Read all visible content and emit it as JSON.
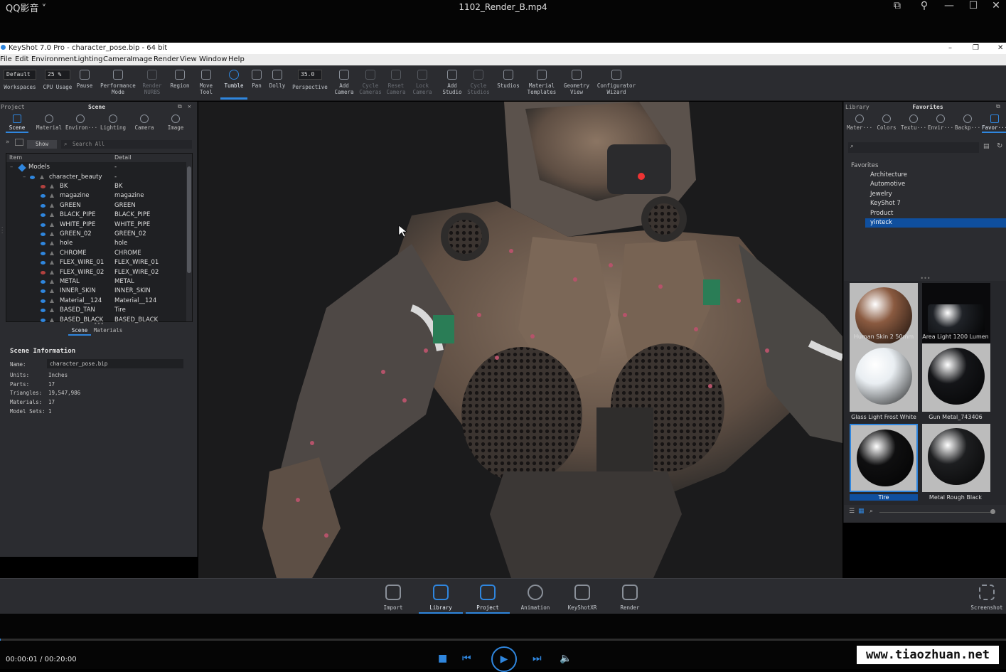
{
  "player": {
    "brand": "QQ影音 ˅",
    "file_title": "1102_Render_B.mp4",
    "time": "00:00:01 / 00:20:00",
    "progress": 0.001,
    "watermark": "www.tiaozhuan.net"
  },
  "keyshot": {
    "window_title": "KeyShot 7.0 Pro  - character_pose.bip  - 64 bit",
    "menu": [
      "File",
      "Edit",
      "Environment",
      "Lighting",
      "Camera",
      "Image",
      "Render",
      "View",
      "Window",
      "Help"
    ],
    "toolbar": {
      "workspace_value": "Default",
      "cpu_value": "25 %",
      "fov_value": "35.0",
      "items": [
        {
          "label": "Workspaces"
        },
        {
          "label": "CPU Usage"
        },
        {
          "label": "Pause"
        },
        {
          "label": "Performance Mode"
        },
        {
          "label": "Render NURBS",
          "dim": true
        },
        {
          "label": "Region"
        },
        {
          "label": "Move Tool"
        },
        {
          "label": "Tumble",
          "active": true
        },
        {
          "label": "Pan"
        },
        {
          "label": "Dolly"
        },
        {
          "label": "Perspective"
        },
        {
          "label": "Add Camera"
        },
        {
          "label": "Cycle Cameras",
          "dim": true
        },
        {
          "label": "Reset Camera",
          "dim": true
        },
        {
          "label": "Lock Camera",
          "dim": true
        },
        {
          "label": "Add Studio"
        },
        {
          "label": "Cycle Studios",
          "dim": true
        },
        {
          "label": "Studios"
        },
        {
          "label": "Material Templates"
        },
        {
          "label": "Geometry View"
        },
        {
          "label": "Configurator Wizard"
        }
      ]
    },
    "left_panel": {
      "tab_project": "Project",
      "title": "Scene",
      "tabs": [
        "Scene",
        "Material",
        "Environ···",
        "Lighting",
        "Camera",
        "Image"
      ],
      "show_button": "Show",
      "search_placeholder": "Search All",
      "col_item": "Item",
      "col_detail": "Detail",
      "root": "Models",
      "root_detail": "-",
      "group": "character_beauty",
      "group_detail": "-",
      "rows": [
        {
          "name": "BK",
          "detail": "BK",
          "hidden": true
        },
        {
          "name": "magazine",
          "detail": "magazine"
        },
        {
          "name": "GREEN",
          "detail": "GREEN"
        },
        {
          "name": "BLACK_PIPE",
          "detail": "BLACK_PIPE"
        },
        {
          "name": "WHITE_PIPE",
          "detail": "WHITE_PIPE"
        },
        {
          "name": "GREEN_02",
          "detail": "GREEN_02"
        },
        {
          "name": "hole",
          "detail": "hole"
        },
        {
          "name": "CHROME",
          "detail": "CHROME"
        },
        {
          "name": "FLEX_WIRE_01",
          "detail": "FLEX_WIRE_01"
        },
        {
          "name": "FLEX_WIRE_02",
          "detail": "FLEX_WIRE_02",
          "hidden": true
        },
        {
          "name": "METAL",
          "detail": "METAL"
        },
        {
          "name": "INNER_SKIN",
          "detail": "INNER_SKIN"
        },
        {
          "name": "Material__124",
          "detail": "Material__124"
        },
        {
          "name": "BASED_TAN",
          "detail": "Tire"
        },
        {
          "name": "BASED_BLACK",
          "detail": "BASED_BLACK"
        }
      ],
      "bottom_tabs": [
        "Scene",
        "Materials"
      ],
      "info_title": "Scene Information",
      "info": [
        {
          "k": "Name:",
          "v": "character_pose.bip"
        },
        {
          "k": "Units:",
          "v": "Inches"
        },
        {
          "k": "Parts:",
          "v": "17"
        },
        {
          "k": "Triangles:",
          "v": "19,547,986"
        },
        {
          "k": "Materials:",
          "v": "17"
        },
        {
          "k": "Model Sets:",
          "v": "1"
        }
      ]
    },
    "right_panel": {
      "tab_library": "Library",
      "title": "Favorites",
      "tabs": [
        "Mater···",
        "Colors",
        "Textu···",
        "Envir···",
        "Backp···",
        "Favor···"
      ],
      "root": "Favorites",
      "folders": [
        "Architecture",
        "Automotive",
        "Jewelry",
        "KeyShot 7",
        "Product",
        "yinteck"
      ],
      "selected_folder": "yinteck",
      "thumbs": [
        {
          "label": "Human Skin 2 50mm",
          "color": "#8a5a40"
        },
        {
          "label": "Area Light 1200 Lumen ...",
          "color": "#202328"
        },
        {
          "label": "Glass Light Frost White",
          "color": "#e9eef2"
        },
        {
          "label": "Gun Metal_743406",
          "color": "#141518"
        },
        {
          "label": "Tire",
          "color": "#0f0f10"
        },
        {
          "label": "Metal Rough Black",
          "color": "#1d1e20"
        }
      ]
    },
    "ribbon": [
      {
        "label": "Import"
      },
      {
        "label": "Library",
        "on": true
      },
      {
        "label": "Project",
        "on": true
      },
      {
        "label": "Animation"
      },
      {
        "label": "KeyShotXR"
      },
      {
        "label": "Render"
      }
    ],
    "screenshot_label": "Screenshot"
  }
}
